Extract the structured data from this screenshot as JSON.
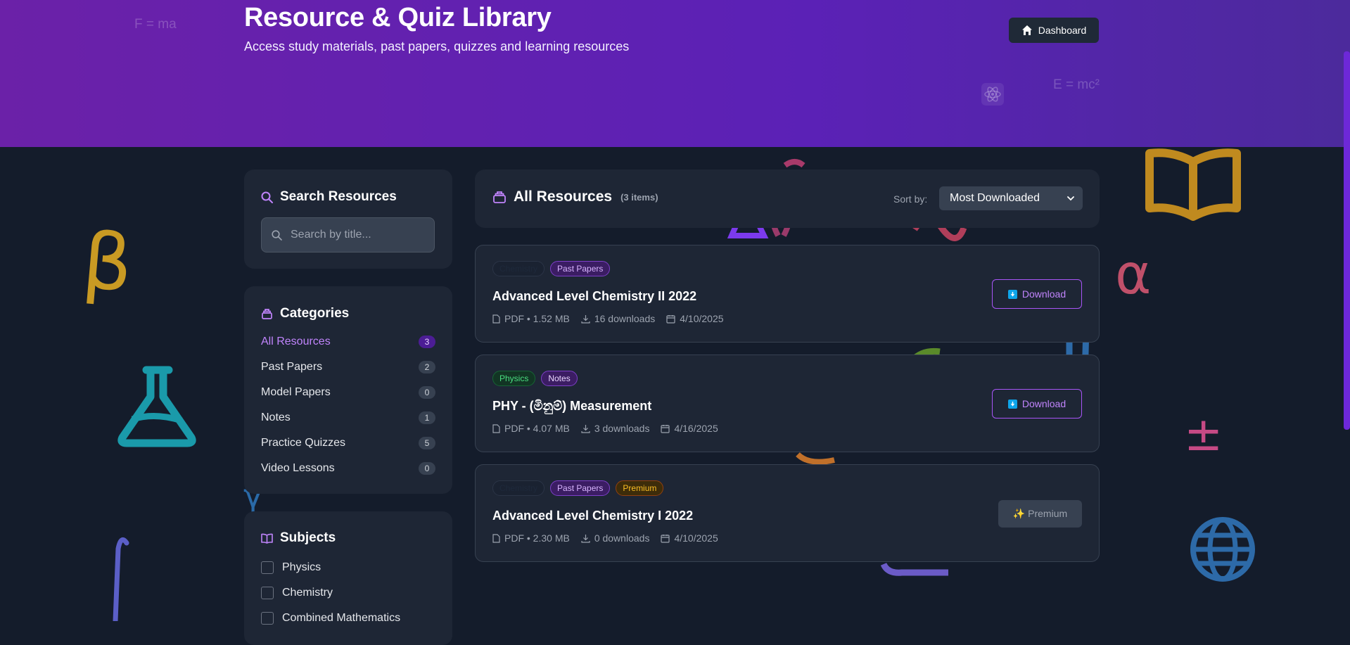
{
  "header": {
    "title": "Resource & Quiz Library",
    "subtitle": "Access study materials, past papers, quizzes and learning resources",
    "dashboard_label": "Dashboard",
    "formula_left": "F = ma",
    "formula_right": "E = mc²"
  },
  "decor": {
    "beta": "β",
    "alpha": "α",
    "plus_minus": "±"
  },
  "search": {
    "title": "Search Resources",
    "placeholder": "Search by title..."
  },
  "categories": {
    "title": "Categories",
    "items": [
      {
        "label": "All Resources",
        "count": "3"
      },
      {
        "label": "Past Papers",
        "count": "2"
      },
      {
        "label": "Model Papers",
        "count": "0"
      },
      {
        "label": "Notes",
        "count": "1"
      },
      {
        "label": "Practice Quizzes",
        "count": "5"
      },
      {
        "label": "Video Lessons",
        "count": "0"
      }
    ]
  },
  "subjects": {
    "title": "Subjects",
    "items": [
      {
        "label": "Physics"
      },
      {
        "label": "Chemistry"
      },
      {
        "label": "Combined Mathematics"
      }
    ]
  },
  "resources_header": {
    "title": "All Resources",
    "count": "(3 items)",
    "sort_label": "Sort by:",
    "sort_value": "Most Downloaded"
  },
  "resources": [
    {
      "tags": [
        "Chemistry",
        "Past Papers"
      ],
      "title": "Advanced Level Chemistry II 2022",
      "file": "PDF • 1.52 MB",
      "downloads": "16 downloads",
      "date": "4/10/2025",
      "action": "Download"
    },
    {
      "tags": [
        "Physics",
        "Notes"
      ],
      "title": "PHY - (මිනුම්) Measurement",
      "file": "PDF • 4.07 MB",
      "downloads": "3 downloads",
      "date": "4/16/2025",
      "action": "Download"
    },
    {
      "tags": [
        "Chemistry",
        "Past Papers",
        "Premium"
      ],
      "title": "Advanced Level Chemistry I 2022",
      "file": "PDF • 2.30 MB",
      "downloads": "0 downloads",
      "date": "4/10/2025",
      "action": "✨ Premium"
    }
  ],
  "colors": {
    "accent": "#a855f7",
    "hero_start": "#6b21a8",
    "hero_end": "#4c2a9c",
    "background": "#141c2b",
    "card": "#1e2635"
  }
}
